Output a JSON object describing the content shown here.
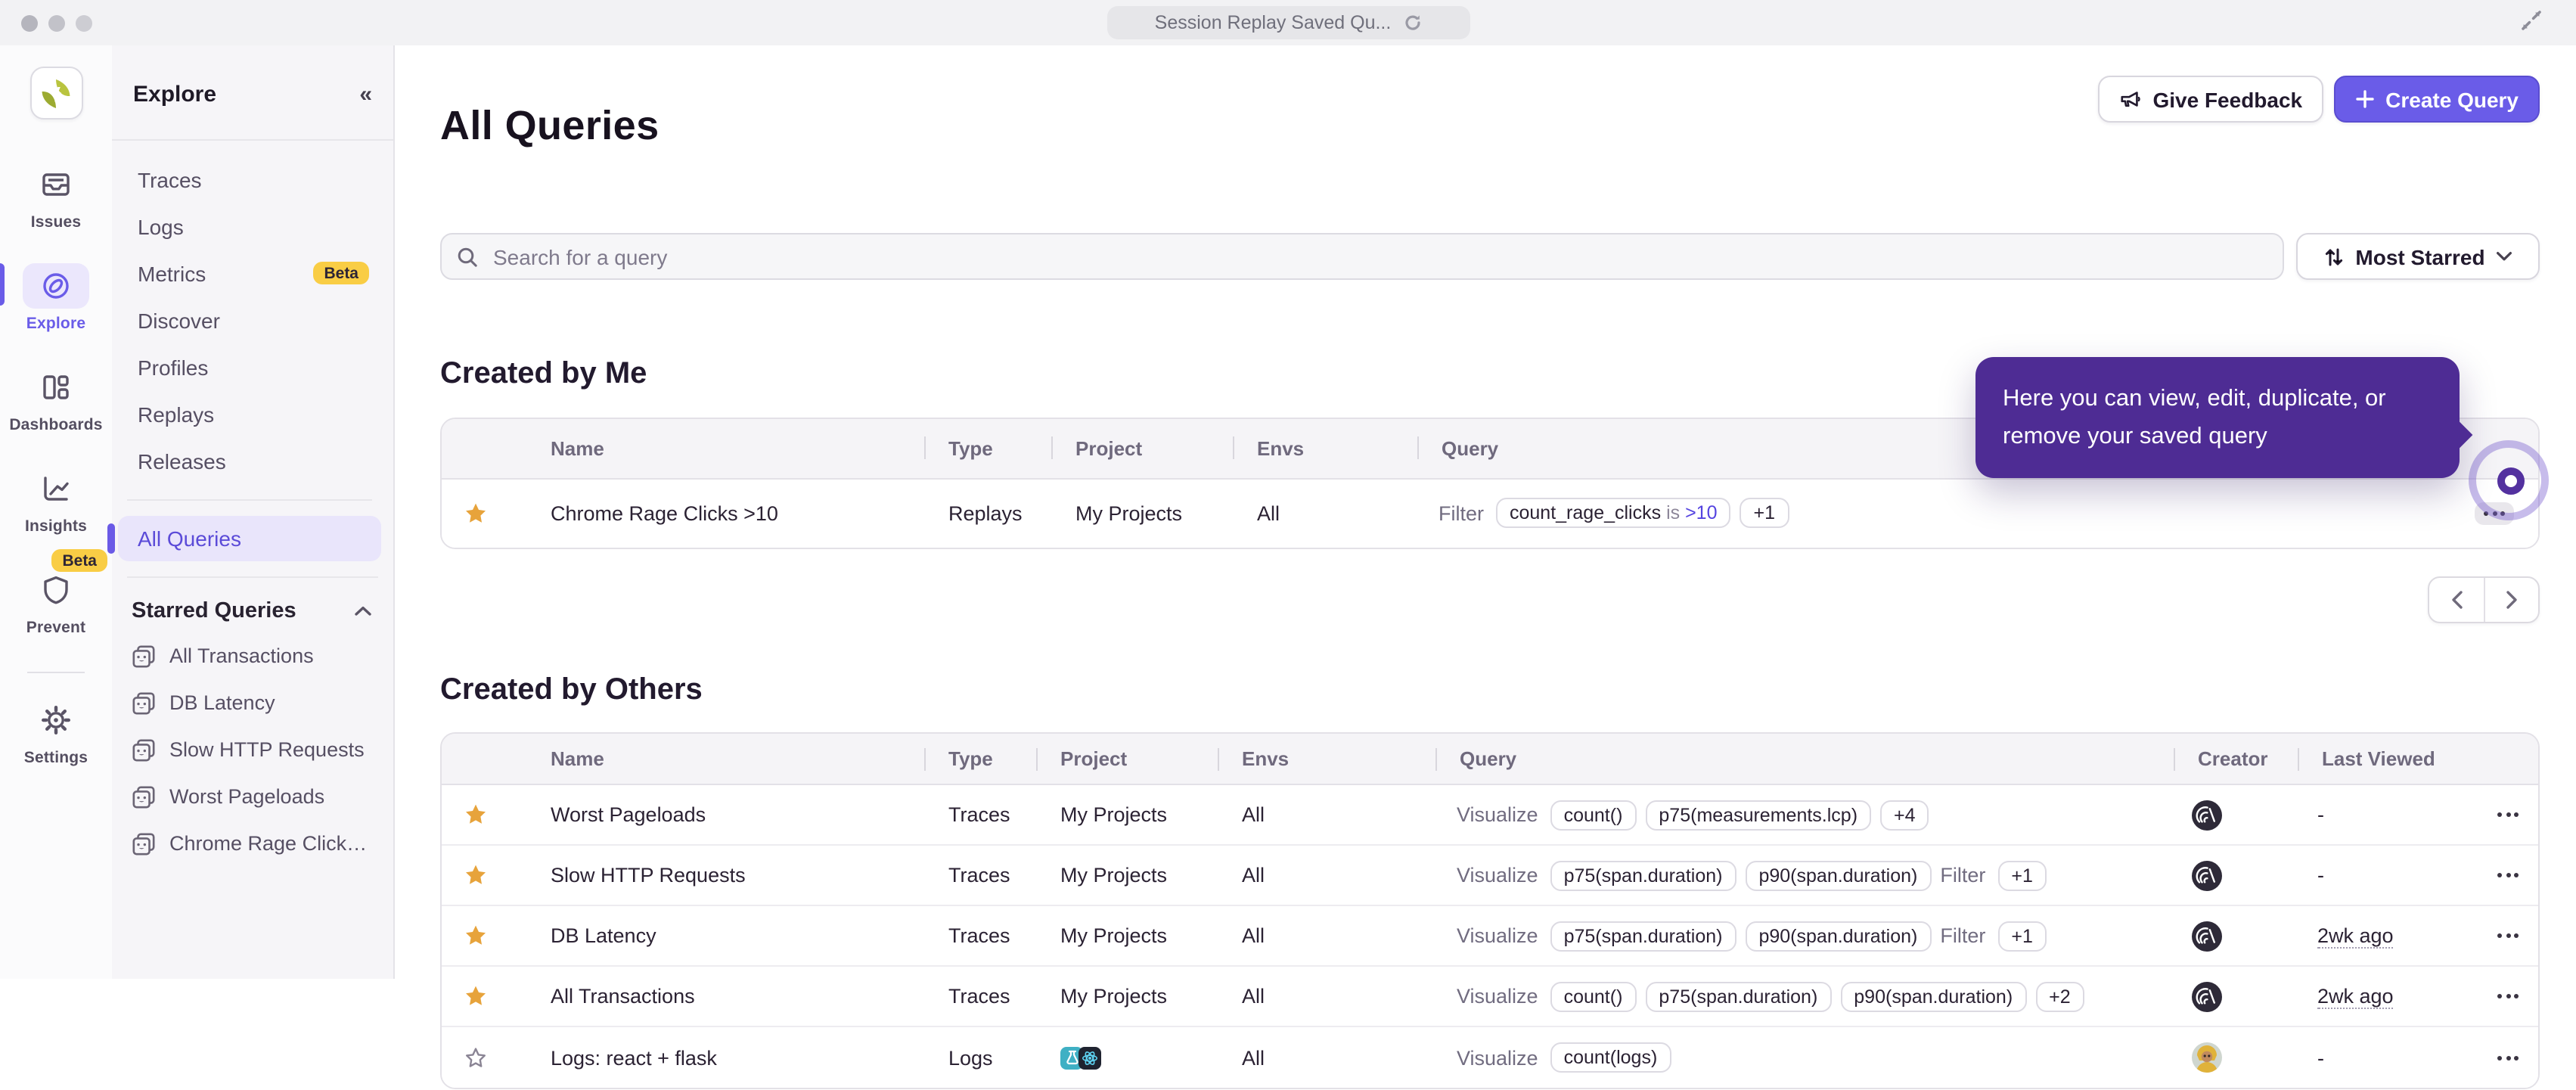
{
  "window": {
    "tab_title": "Session Replay Saved Qu...",
    "colors": {
      "accent": "#6a5ce8",
      "tooltip": "#4e2c94",
      "star": "#e7a33b",
      "badge": "#f9cd45"
    }
  },
  "rail": {
    "items": [
      {
        "label": "Issues",
        "icon": "issues"
      },
      {
        "label": "Explore",
        "icon": "explore",
        "active": true
      },
      {
        "label": "Dashboards",
        "icon": "dashboards"
      },
      {
        "label": "Insights",
        "icon": "insights"
      },
      {
        "label": "Prevent",
        "icon": "prevent",
        "badge": "Beta"
      },
      {
        "label": "Settings",
        "icon": "settings",
        "divider_before": true
      }
    ]
  },
  "explore_panel": {
    "title": "Explore",
    "items": [
      {
        "label": "Traces"
      },
      {
        "label": "Logs"
      },
      {
        "label": "Metrics",
        "badge": "Beta"
      },
      {
        "label": "Discover"
      },
      {
        "label": "Profiles"
      },
      {
        "label": "Replays"
      },
      {
        "label": "Releases"
      },
      {
        "label": "All Queries",
        "active": true,
        "divider_before": true
      }
    ],
    "starred": {
      "title": "Starred Queries",
      "items": [
        "All Transactions",
        "DB Latency",
        "Slow HTTP Requests",
        "Worst Pageloads",
        "Chrome Rage Click…"
      ]
    }
  },
  "header": {
    "title": "All Queries",
    "give_feedback": "Give Feedback",
    "create_query": "Create Query"
  },
  "toolbar": {
    "search_placeholder": "Search for a query",
    "sort_label": "Most Starred"
  },
  "tables": {
    "created_by_me": {
      "heading": "Created by Me",
      "columns": [
        "Name",
        "Type",
        "Project",
        "Envs",
        "Query"
      ],
      "rows": [
        {
          "starred": true,
          "name": "Chrome Rage Clicks >10",
          "type": "Replays",
          "project": "My Projects",
          "envs": "All",
          "query": [
            {
              "t": "label",
              "v": "Filter"
            },
            {
              "t": "chip",
              "parts": [
                {
                  "v": "count_rage_clicks "
                },
                {
                  "v": "is ",
                  "muted": true
                },
                {
                  "v": ">10",
                  "accent": true
                }
              ]
            },
            {
              "t": "chip",
              "v": "+1"
            }
          ],
          "creator": null,
          "last_viewed": null,
          "actions_highlight": true
        }
      ]
    },
    "created_by_others": {
      "heading": "Created by Others",
      "columns": [
        "Name",
        "Type",
        "Project",
        "Envs",
        "Query",
        "Creator",
        "Last Viewed"
      ],
      "rows": [
        {
          "starred": true,
          "name": "Worst Pageloads",
          "type": "Traces",
          "project": "My Projects",
          "envs": "All",
          "query": [
            {
              "t": "label",
              "v": "Visualize"
            },
            {
              "t": "chip",
              "v": "count()"
            },
            {
              "t": "chip",
              "v": "p75(measurements.lcp)"
            },
            {
              "t": "chip",
              "v": "+4"
            }
          ],
          "creator": "sentry",
          "last_viewed": "-"
        },
        {
          "starred": true,
          "name": "Slow HTTP Requests",
          "type": "Traces",
          "project": "My Projects",
          "envs": "All",
          "query": [
            {
              "t": "label",
              "v": "Visualize"
            },
            {
              "t": "chip",
              "v": "p75(span.duration)"
            },
            {
              "t": "chip",
              "v": "p90(span.duration)"
            },
            {
              "t": "label",
              "v": "Filter"
            },
            {
              "t": "chip",
              "v": "+1"
            }
          ],
          "creator": "sentry",
          "last_viewed": "-"
        },
        {
          "starred": true,
          "name": "DB Latency",
          "type": "Traces",
          "project": "My Projects",
          "envs": "All",
          "query": [
            {
              "t": "label",
              "v": "Visualize"
            },
            {
              "t": "chip",
              "v": "p75(span.duration)"
            },
            {
              "t": "chip",
              "v": "p90(span.duration)"
            },
            {
              "t": "label",
              "v": "Filter"
            },
            {
              "t": "chip",
              "v": "+1"
            }
          ],
          "creator": "sentry",
          "last_viewed": "2wk ago"
        },
        {
          "starred": true,
          "name": "All Transactions",
          "type": "Traces",
          "project": "My Projects",
          "envs": "All",
          "query": [
            {
              "t": "label",
              "v": "Visualize"
            },
            {
              "t": "chip",
              "v": "count()"
            },
            {
              "t": "chip",
              "v": "p75(span.duration)"
            },
            {
              "t": "chip",
              "v": "p90(span.duration)"
            },
            {
              "t": "chip",
              "v": "+2"
            }
          ],
          "creator": "sentry",
          "last_viewed": "2wk ago"
        },
        {
          "starred": false,
          "name": "Logs: react + flask",
          "type": "Logs",
          "project": null,
          "project_icons": [
            "flask",
            "react"
          ],
          "envs": "All",
          "query": [
            {
              "t": "label",
              "v": "Visualize"
            },
            {
              "t": "chip",
              "v": "count(logs)"
            }
          ],
          "creator": "person",
          "last_viewed": "-"
        }
      ]
    }
  },
  "tooltip": {
    "text": "Here you can view, edit, duplicate, or remove your saved query"
  }
}
